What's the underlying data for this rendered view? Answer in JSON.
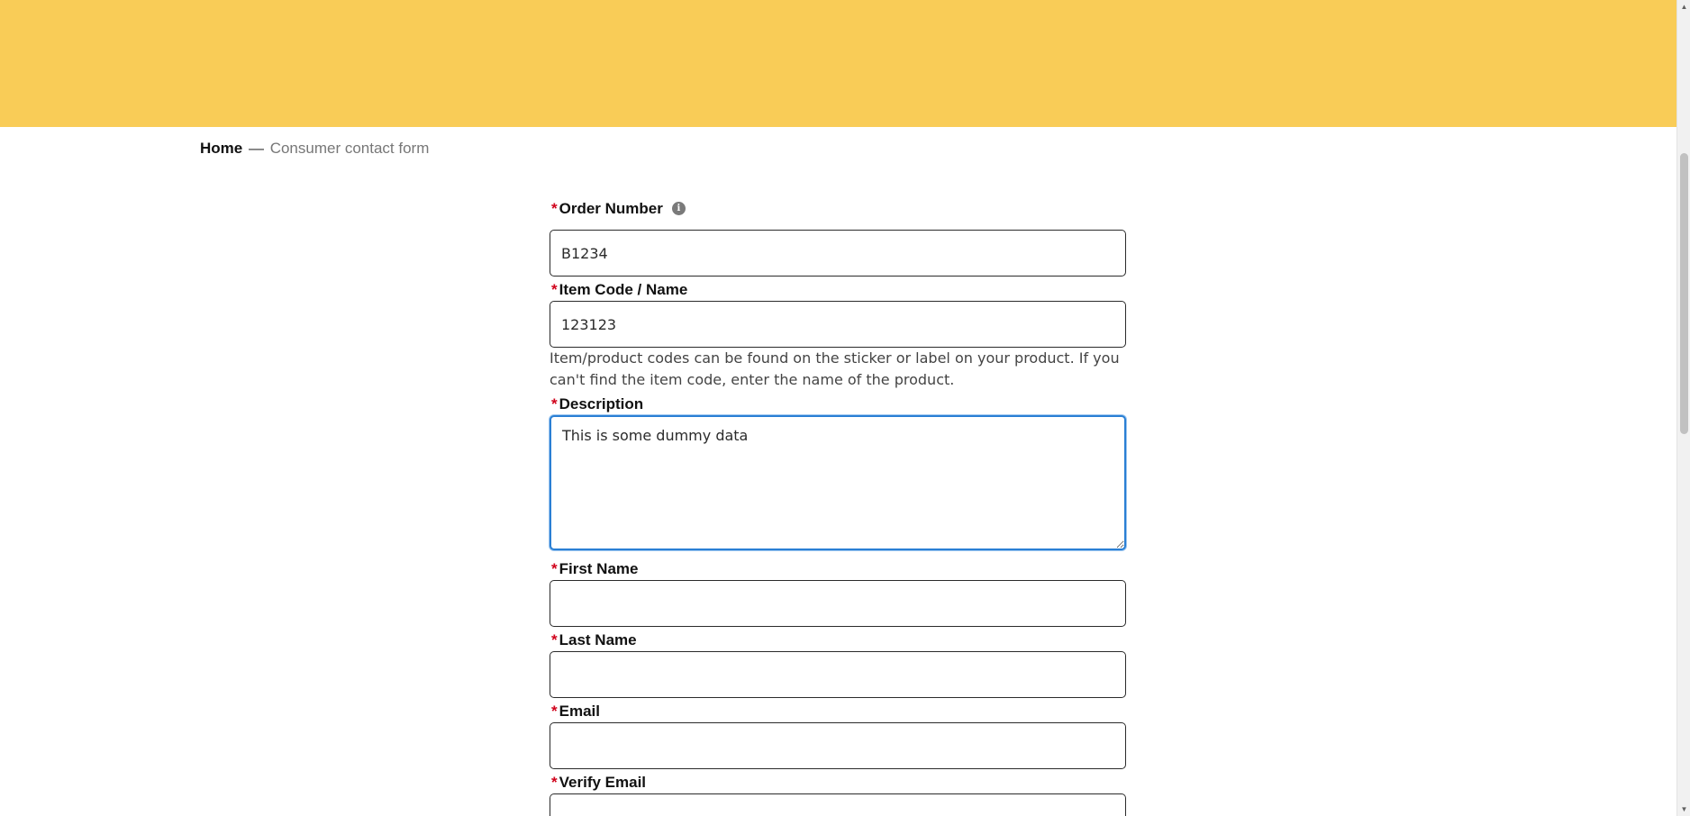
{
  "breadcrumb": {
    "home": "Home",
    "separator": "—",
    "current": "Consumer contact form"
  },
  "form": {
    "order_number": {
      "label": "Order Number",
      "required_mark": "*",
      "value": "B1234",
      "info_icon": "info-icon"
    },
    "item_code": {
      "label": "Item Code / Name",
      "required_mark": "*",
      "value": "123123",
      "help": "Item/product codes can be found on the sticker or label on your product. If you can't find the item code, enter the name of the product."
    },
    "description": {
      "label": "Description",
      "required_mark": "*",
      "value": "This is some dummy data"
    },
    "first_name": {
      "label": "First Name",
      "required_mark": "*",
      "value": ""
    },
    "last_name": {
      "label": "Last Name",
      "required_mark": "*",
      "value": ""
    },
    "email": {
      "label": "Email",
      "required_mark": "*",
      "value": ""
    },
    "verify_email": {
      "label": "Verify Email",
      "required_mark": "*",
      "value": ""
    }
  },
  "colors": {
    "banner": "#f9cc57",
    "required": "#d0021b",
    "focus_border": "#2a7fd4"
  }
}
